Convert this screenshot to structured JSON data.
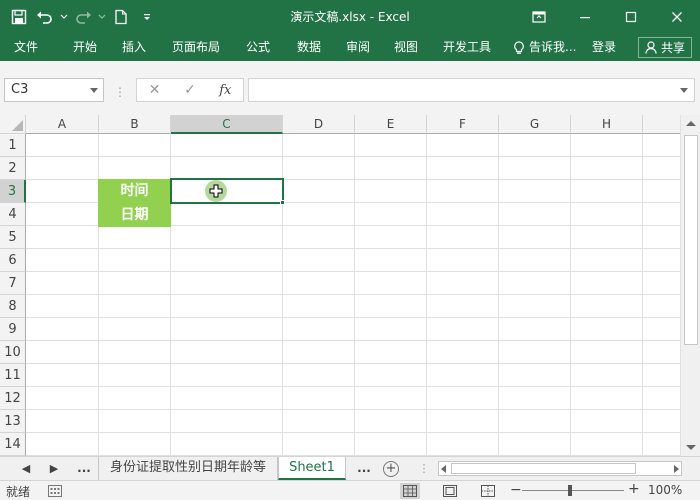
{
  "titlebar": {
    "title": "演示文稿.xlsx - Excel",
    "accent": "#217346"
  },
  "ribbon_tabs": [
    "文件",
    "开始",
    "插入",
    "页面布局",
    "公式",
    "数据",
    "审阅",
    "视图",
    "开发工具"
  ],
  "tell_me": "告诉我...",
  "login": "登录",
  "share": "共享",
  "name_box": "C3",
  "formula_value": "",
  "columns": [
    "A",
    "B",
    "C",
    "D",
    "E",
    "F",
    "G",
    "H"
  ],
  "rows": [
    "1",
    "2",
    "3",
    "4",
    "5",
    "6",
    "7",
    "8",
    "9",
    "10",
    "11",
    "12",
    "13",
    "14"
  ],
  "selected_cell": "C3",
  "cells": {
    "B3": "时间",
    "B4": "日期",
    "fill_color": "#92d050"
  },
  "sheet_nav": {
    "prev": "◀",
    "next": "▶",
    "more_left": "...",
    "more_right": "..."
  },
  "sheets": [
    "身份证提取性别日期年龄等",
    "Sheet1"
  ],
  "active_sheet": "Sheet1",
  "add_sheet": "+",
  "status": {
    "text": "就绪",
    "zoom_minus": "−",
    "zoom_plus": "+",
    "zoom": "100%",
    "zoom_fraction": 0.5
  }
}
